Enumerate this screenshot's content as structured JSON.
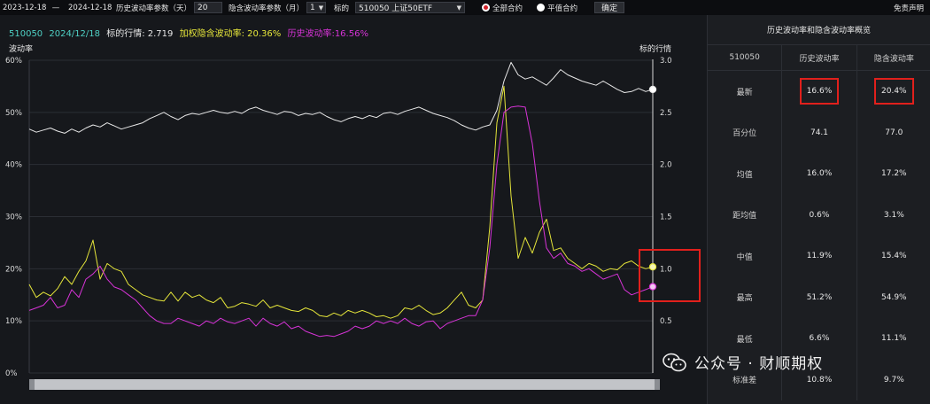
{
  "toolbar": {
    "start_date": "2023-12-18",
    "dash": "—",
    "end_date": "2024-12-18",
    "hv_param_label": "历史波动率参数（天）",
    "hv_param_value": "20",
    "iv_param_label": "隐含波动率参数（月）",
    "iv_param_value": "1",
    "underlying_label": "标的",
    "underlying_value": "510050 上证50ETF",
    "radio_all": "全部合约",
    "radio_atm": "平值合约",
    "confirm": "确定",
    "disclaimer": "免责声明"
  },
  "legend": {
    "code": "510050",
    "date": "2024/12/18",
    "price_label": "标的行情: 2.719",
    "iv_label": "加权隐含波动率: 20.36%",
    "hv_label": "历史波动率:16.56%"
  },
  "colors": {
    "price": "#e8e8e8",
    "iv": "#e5e53a",
    "hv": "#d733d7",
    "code": "#4fd1c5",
    "highlight": "#e1201c"
  },
  "chart_data": {
    "type": "line",
    "ylabel": "波动率",
    "y2label": "标的行情",
    "ylim": [
      0,
      60
    ],
    "y2lim": [
      0,
      3.0
    ],
    "yticks": [
      "60%",
      "50%",
      "40%",
      "30%",
      "20%",
      "10%",
      "0%"
    ],
    "y2ticks": [
      "3.0",
      "2.5",
      "2.0",
      "1.5",
      "1.0",
      "0.5"
    ],
    "series": [
      {
        "name": "标的行情",
        "axis": "right",
        "values": [
          2.34,
          2.31,
          2.33,
          2.35,
          2.32,
          2.3,
          2.34,
          2.31,
          2.35,
          2.38,
          2.36,
          2.4,
          2.37,
          2.34,
          2.36,
          2.38,
          2.4,
          2.44,
          2.47,
          2.5,
          2.46,
          2.43,
          2.47,
          2.49,
          2.48,
          2.5,
          2.52,
          2.5,
          2.49,
          2.51,
          2.49,
          2.53,
          2.55,
          2.52,
          2.5,
          2.48,
          2.51,
          2.5,
          2.47,
          2.49,
          2.48,
          2.5,
          2.46,
          2.43,
          2.41,
          2.44,
          2.46,
          2.44,
          2.47,
          2.45,
          2.49,
          2.5,
          2.48,
          2.51,
          2.53,
          2.55,
          2.52,
          2.49,
          2.47,
          2.45,
          2.42,
          2.38,
          2.35,
          2.33,
          2.36,
          2.38,
          2.52,
          2.8,
          2.98,
          2.86,
          2.82,
          2.84,
          2.8,
          2.76,
          2.83,
          2.91,
          2.86,
          2.83,
          2.8,
          2.78,
          2.76,
          2.8,
          2.76,
          2.72,
          2.69,
          2.7,
          2.73,
          2.7,
          2.72
        ],
        "color": "#e8e8e8"
      },
      {
        "name": "加权隐含波动率",
        "axis": "left",
        "values": [
          17.0,
          14.5,
          15.5,
          14.8,
          16.2,
          18.5,
          17.0,
          19.5,
          21.5,
          25.5,
          18.0,
          21.0,
          20.0,
          19.5,
          17.0,
          16.0,
          15.0,
          14.5,
          14.0,
          13.8,
          15.5,
          13.8,
          15.5,
          14.5,
          15.0,
          14.0,
          13.5,
          14.5,
          12.5,
          12.8,
          13.5,
          13.2,
          12.8,
          14.0,
          12.5,
          13.0,
          12.5,
          12.0,
          11.8,
          12.5,
          12.0,
          11.0,
          10.8,
          11.5,
          11.0,
          12.0,
          11.5,
          12.0,
          11.5,
          10.8,
          11.0,
          10.5,
          11.0,
          12.5,
          12.2,
          13.0,
          12.0,
          11.2,
          11.5,
          12.5,
          14.0,
          15.5,
          13.0,
          12.5,
          14.0,
          28.0,
          48.0,
          55.0,
          34.0,
          22.0,
          26.0,
          23.0,
          27.0,
          29.5,
          23.5,
          24.0,
          22.0,
          21.0,
          20.0,
          21.0,
          20.5,
          19.5,
          20.0,
          19.8,
          21.0,
          21.5,
          20.5,
          20.0,
          20.36
        ],
        "color": "#e5e53a"
      },
      {
        "name": "历史波动率",
        "axis": "left",
        "values": [
          12.0,
          12.5,
          13.0,
          14.5,
          12.5,
          13.0,
          16.0,
          14.5,
          18.0,
          19.0,
          20.5,
          18.0,
          16.5,
          16.0,
          15.0,
          14.0,
          12.5,
          11.0,
          10.0,
          9.5,
          9.5,
          10.5,
          10.0,
          9.5,
          9.0,
          10.0,
          9.5,
          10.5,
          9.8,
          9.5,
          10.0,
          10.5,
          9.0,
          10.5,
          9.5,
          9.0,
          9.8,
          8.5,
          9.0,
          8.0,
          7.5,
          7.0,
          7.2,
          7.0,
          7.5,
          8.0,
          9.0,
          8.5,
          9.0,
          10.0,
          9.5,
          10.0,
          9.5,
          10.5,
          9.5,
          9.0,
          9.8,
          10.0,
          8.5,
          9.5,
          10.0,
          10.5,
          11.0,
          11.0,
          14.0,
          24.0,
          40.0,
          50.0,
          51.0,
          51.2,
          51.0,
          44.0,
          33.0,
          24.0,
          22.0,
          23.0,
          21.0,
          20.5,
          19.5,
          20.0,
          19.0,
          18.0,
          18.5,
          19.0,
          16.0,
          15.0,
          15.5,
          16.0,
          16.56
        ],
        "color": "#d733d7"
      }
    ],
    "highlight": {
      "series_index_range": [
        84,
        88
      ]
    }
  },
  "panel": {
    "title": "历史波动率和隐含波动率概览",
    "headers": [
      "510050",
      "历史波动率",
      "隐含波动率"
    ],
    "rows": [
      {
        "label": "最新",
        "hv": "16.6%",
        "iv": "20.4%",
        "highlight": true
      },
      {
        "label": "百分位",
        "hv": "74.1",
        "iv": "77.0"
      },
      {
        "label": "均值",
        "hv": "16.0%",
        "iv": "17.2%"
      },
      {
        "label": "距均值",
        "hv": "0.6%",
        "iv": "3.1%"
      },
      {
        "label": "中值",
        "hv": "11.9%",
        "iv": "15.4%"
      },
      {
        "label": "最高",
        "hv": "51.2%",
        "iv": "54.9%"
      },
      {
        "label": "最低",
        "hv": "6.6%",
        "iv": "11.1%"
      },
      {
        "label": "标准差",
        "hv": "10.8%",
        "iv": "9.7%"
      }
    ]
  },
  "watermark": "公众号 · 财顺期权"
}
